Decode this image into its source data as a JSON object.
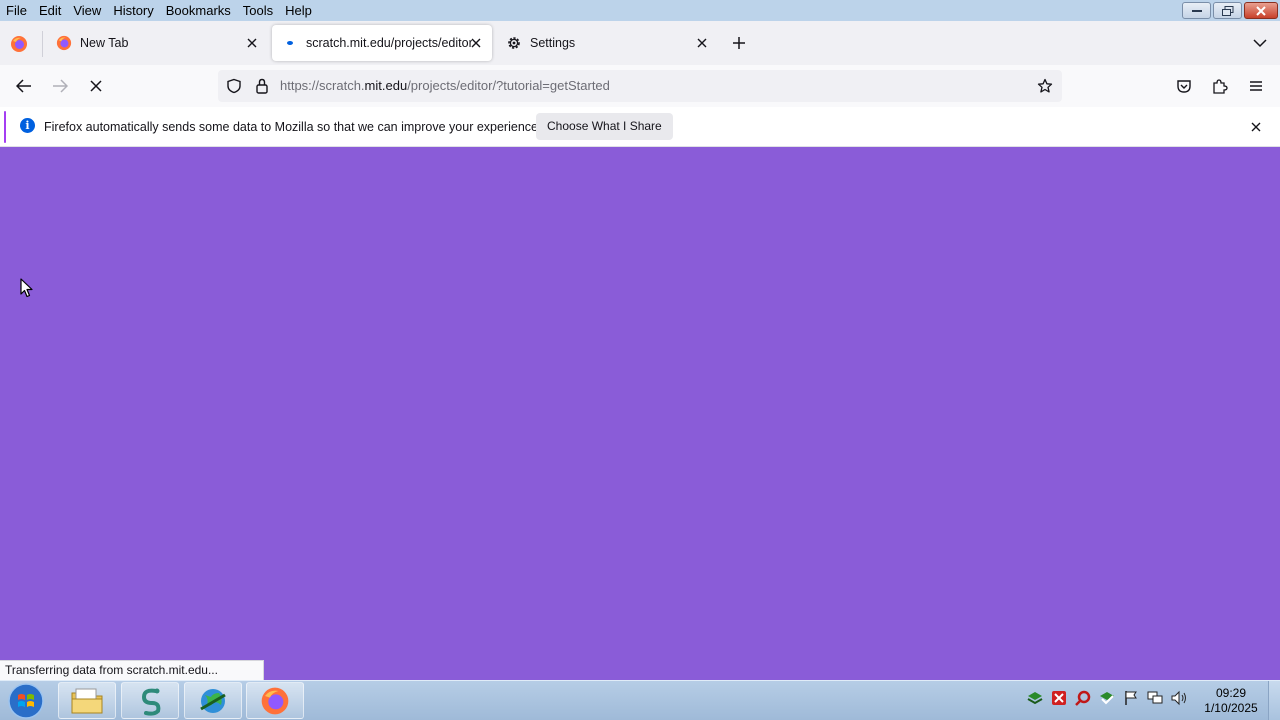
{
  "menubar": {
    "items": [
      "File",
      "Edit",
      "View",
      "History",
      "Bookmarks",
      "Tools",
      "Help"
    ]
  },
  "tabs": [
    {
      "title": "New Tab",
      "icon": "firefox-icon",
      "active": false
    },
    {
      "title": "scratch.mit.edu/projects/editor",
      "icon": "loading-dot-icon",
      "active": true
    },
    {
      "title": "Settings",
      "icon": "gear-icon",
      "active": false
    }
  ],
  "navbar": {
    "url_prefix": "https://scratch.",
    "url_host": "mit.edu",
    "url_rest": "/projects/editor/?tutorial=getStarted"
  },
  "notification": {
    "message": "Firefox automatically sends some data to Mozilla so that we can improve your experience.",
    "button_label": "Choose What I Share"
  },
  "content": {
    "background_color": "#8a5cd8"
  },
  "status": {
    "text": "Transferring data from scratch.mit.edu..."
  },
  "taskbar": {
    "apps": [
      "file-explorer-icon",
      "snake-app-icon",
      "globe-download-icon",
      "firefox-icon"
    ],
    "tray_icons": [
      "network-tray-icon",
      "close-tray-icon",
      "search-tray-icon",
      "check-tray-icon",
      "flag-tray-icon",
      "monitor-tray-icon",
      "volume-tray-icon"
    ],
    "clock_time": "09:29",
    "clock_date": "1/10/2025"
  }
}
